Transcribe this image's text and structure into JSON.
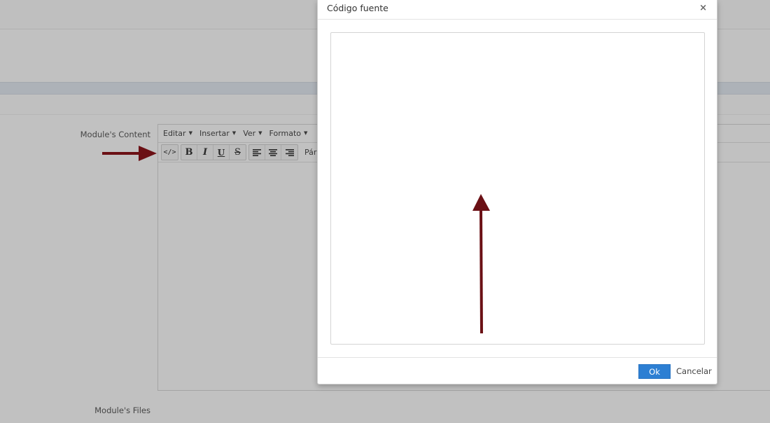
{
  "background": {
    "labels": {
      "content": "Module's Content",
      "files": "Module's Files"
    },
    "editor": {
      "menus": [
        {
          "label": "Editar"
        },
        {
          "label": "Insertar"
        },
        {
          "label": "Ver"
        },
        {
          "label": "Formato"
        }
      ],
      "toolbar": {
        "source_code_icon": "</>",
        "bold": "B",
        "italic": "I",
        "underline": "U",
        "strikethrough": "S",
        "format_select": "Párraf"
      }
    }
  },
  "modal": {
    "title": "Código fuente",
    "close_symbol": "×",
    "code_value": "",
    "ok_label": "Ok",
    "cancel_label": "Cancelar"
  },
  "annotations": {
    "arrow_color": "#6b1015",
    "arrows": [
      {
        "points_to": "source-code-button",
        "direction": "right"
      },
      {
        "points_to": "code-textarea",
        "direction": "up"
      }
    ]
  }
}
